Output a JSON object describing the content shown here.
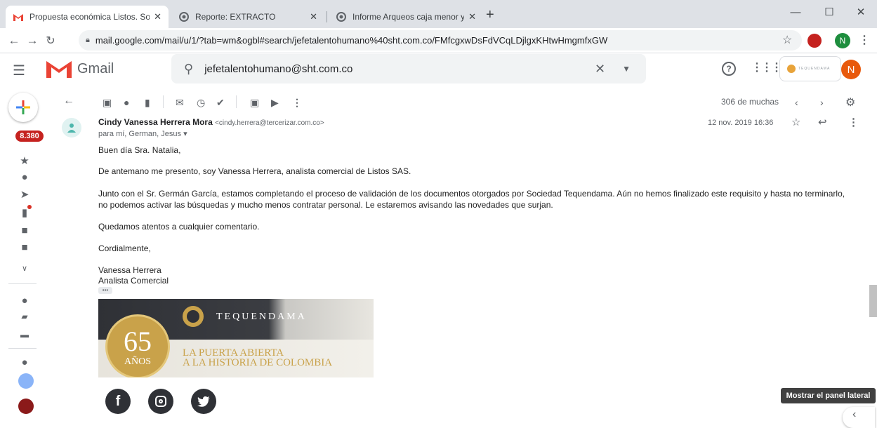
{
  "browser": {
    "tabs": [
      {
        "title": "Propuesta económica Listos. Soci",
        "active": true,
        "favicon": "gmail-icon"
      },
      {
        "title": "Reporte: EXTRACTO",
        "active": false,
        "favicon": "chrome-icon"
      },
      {
        "title": "Informe Arqueos caja menor y de",
        "active": false,
        "favicon": "chrome-icon"
      }
    ],
    "url": "mail.google.com/mail/u/1/?tab=wm&ogbl#search/jefetalentohumano%40sht.com.co/FMfcgxwDsFdVCqLDjlgxKHtwHmgmfxGW",
    "profile_initial": "N"
  },
  "gmail": {
    "brand": "Gmail",
    "search_value": "jefetalentohumano@sht.com.co",
    "account_initial": "N",
    "account_logo_text": "TEQUENDAMA",
    "inbox_badge": "8.380",
    "pagination": "306 de muchas"
  },
  "message": {
    "sender_name": "Cindy Vanessa Herrera Mora",
    "sender_email": "<cindy.herrera@tercerizar.com.co>",
    "recipients": "para mí, German, Jesus",
    "date": "12 nov. 2019 16:36",
    "greeting": "Buen día Sra. Natalia,",
    "p1": "De antemano me presento, soy Vanessa Herrera, analista comercial de Listos SAS.",
    "p2a": "Junto con el Sr. Germán García, estamos completando el proceso de validación de los documentos otorgados por Sociedad Tequendama. Aún no hemos finalizado este requisito y hasta no terminarlo,",
    "p2b": "no podemos activar las búsquedas y mucho menos contratar personal. Le estaremos avisando las novedades que surjan.",
    "p3": "Quedamos atentos a cualquier comentario.",
    "closing": "Cordialmente,",
    "sig_name": "Vanessa Herrera",
    "sig_title": "Analista Comercial",
    "trimmed": "•••",
    "banner_brand": "TEQUENDAMA",
    "banner_years": "65",
    "banner_years_label": "AÑOS",
    "banner_line1": "LA PUERTA ABIERTA",
    "banner_line2": "A LA HISTORIA DE COLOMBIA"
  },
  "side_panel_tooltip": "Mostrar el panel lateral",
  "colors": {
    "gmail_red": "#ea4335",
    "avatar_orange": "#e8590c",
    "profile_teal": "#1e8e3e"
  }
}
